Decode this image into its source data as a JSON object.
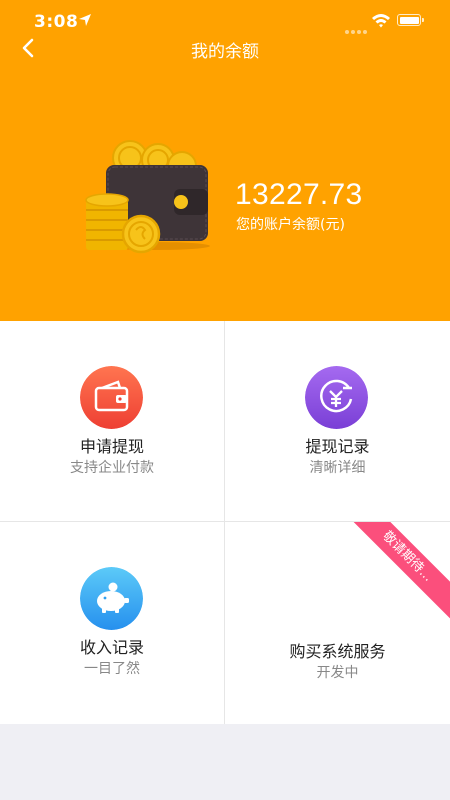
{
  "status_bar": {
    "time": "3:08",
    "icons": [
      "location-arrow-icon",
      "wifi-icon",
      "battery-icon"
    ]
  },
  "nav": {
    "title": "我的余额",
    "back_icon": "chevron-left-icon"
  },
  "balance": {
    "amount": "13227.73",
    "label": "您的账户余额(元)",
    "illustration": "wallet-with-coins-icon"
  },
  "colors": {
    "header_bg": "#ffa200",
    "withdraw_icon": "#f5503a",
    "record_icon": "#8a4fdc",
    "income_icon": "#2f9ff0",
    "ribbon": "#fb4f7c"
  },
  "menu": [
    {
      "title": "申请提现",
      "subtitle": "支持企业付款",
      "icon": "wallet-icon"
    },
    {
      "title": "提现记录",
      "subtitle": "清晰详细",
      "icon": "yen-refresh-icon"
    },
    {
      "title": "收入记录",
      "subtitle": "一目了然",
      "icon": "piggy-bank-icon"
    },
    {
      "title": "购买系统服务",
      "subtitle": "开发中",
      "ribbon": "敬请期待..."
    }
  ]
}
